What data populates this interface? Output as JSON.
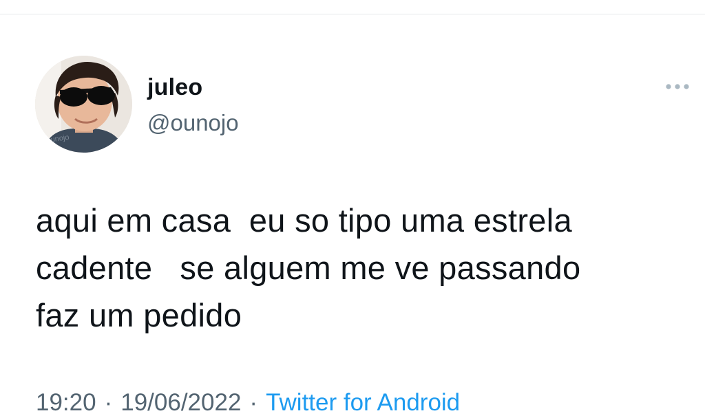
{
  "tweet": {
    "author": {
      "display_name": "juleo",
      "handle": "@ounojo",
      "avatar_watermark": "@ounojo"
    },
    "text": "aqui em casa  eu so tipo uma estrela\ncadente   se alguem me ve passando\nfaz um pedido",
    "meta": {
      "time": "19:20",
      "separator": "·",
      "date": "19/06/2022",
      "source": "Twitter for Android"
    },
    "more_icon": "more-horizontal-icon"
  },
  "colors": {
    "text_primary": "#0f1419",
    "text_secondary": "#536471",
    "link": "#1d9bf0",
    "divider": "#e6e9eb"
  }
}
